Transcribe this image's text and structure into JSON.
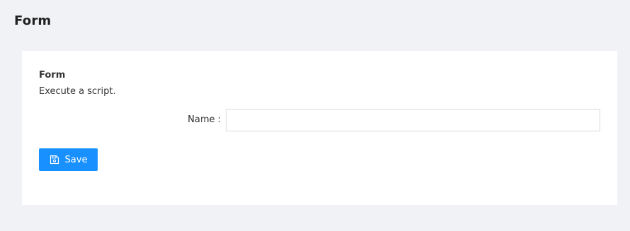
{
  "page": {
    "title": "Form"
  },
  "card": {
    "title": "Form",
    "description": "Execute a script."
  },
  "form": {
    "name_label": "Name :",
    "name_value": "",
    "name_placeholder": ""
  },
  "actions": {
    "save_label": "Save",
    "save_icon": "save-icon"
  },
  "colors": {
    "background": "#f0f2f5",
    "card": "#ffffff",
    "primary": "#1890ff",
    "input_border": "#d9d9d9"
  }
}
